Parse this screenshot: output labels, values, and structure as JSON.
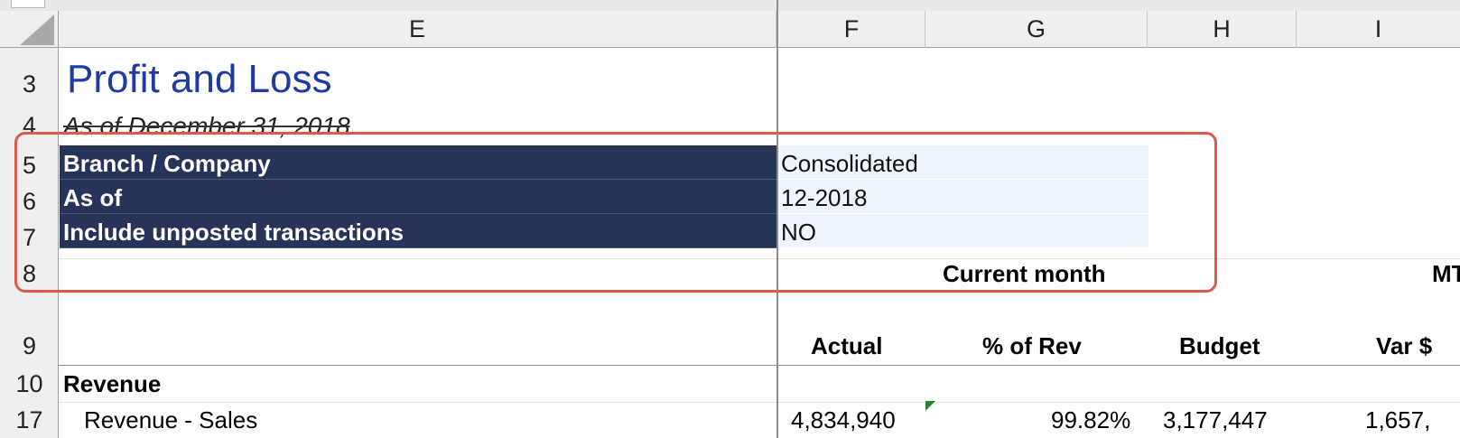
{
  "columns": [
    "E",
    "F",
    "G",
    "H",
    "I"
  ],
  "rows": [
    "3",
    "4",
    "5",
    "6",
    "7",
    "8",
    "9",
    "10",
    "17"
  ],
  "report": {
    "title": "Profit and Loss",
    "subtitle": "As of December 31, 2018"
  },
  "params": [
    {
      "label": "Branch / Company",
      "value": "Consolidated"
    },
    {
      "label": "As of",
      "value": "12-2018"
    },
    {
      "label": "Include unposted transactions",
      "value": "NO"
    }
  ],
  "section_headers": {
    "current_month": "Current month",
    "mtd_partial": "MT"
  },
  "col_headers": {
    "actual": "Actual",
    "pct_rev": "% of Rev",
    "budget": "Budget",
    "var": "Var $"
  },
  "lines": {
    "revenue_group": "Revenue",
    "revenue_sales": {
      "label": "Revenue - Sales",
      "actual": "4,834,940",
      "pct_rev": "99.82%",
      "budget": "3,177,447",
      "var": "1,657,"
    }
  },
  "colors": {
    "title": "#1f3aa0",
    "param_label_bg": "#253458",
    "param_value_bg": "#eef5fd",
    "selection": "#dc5a4a"
  }
}
